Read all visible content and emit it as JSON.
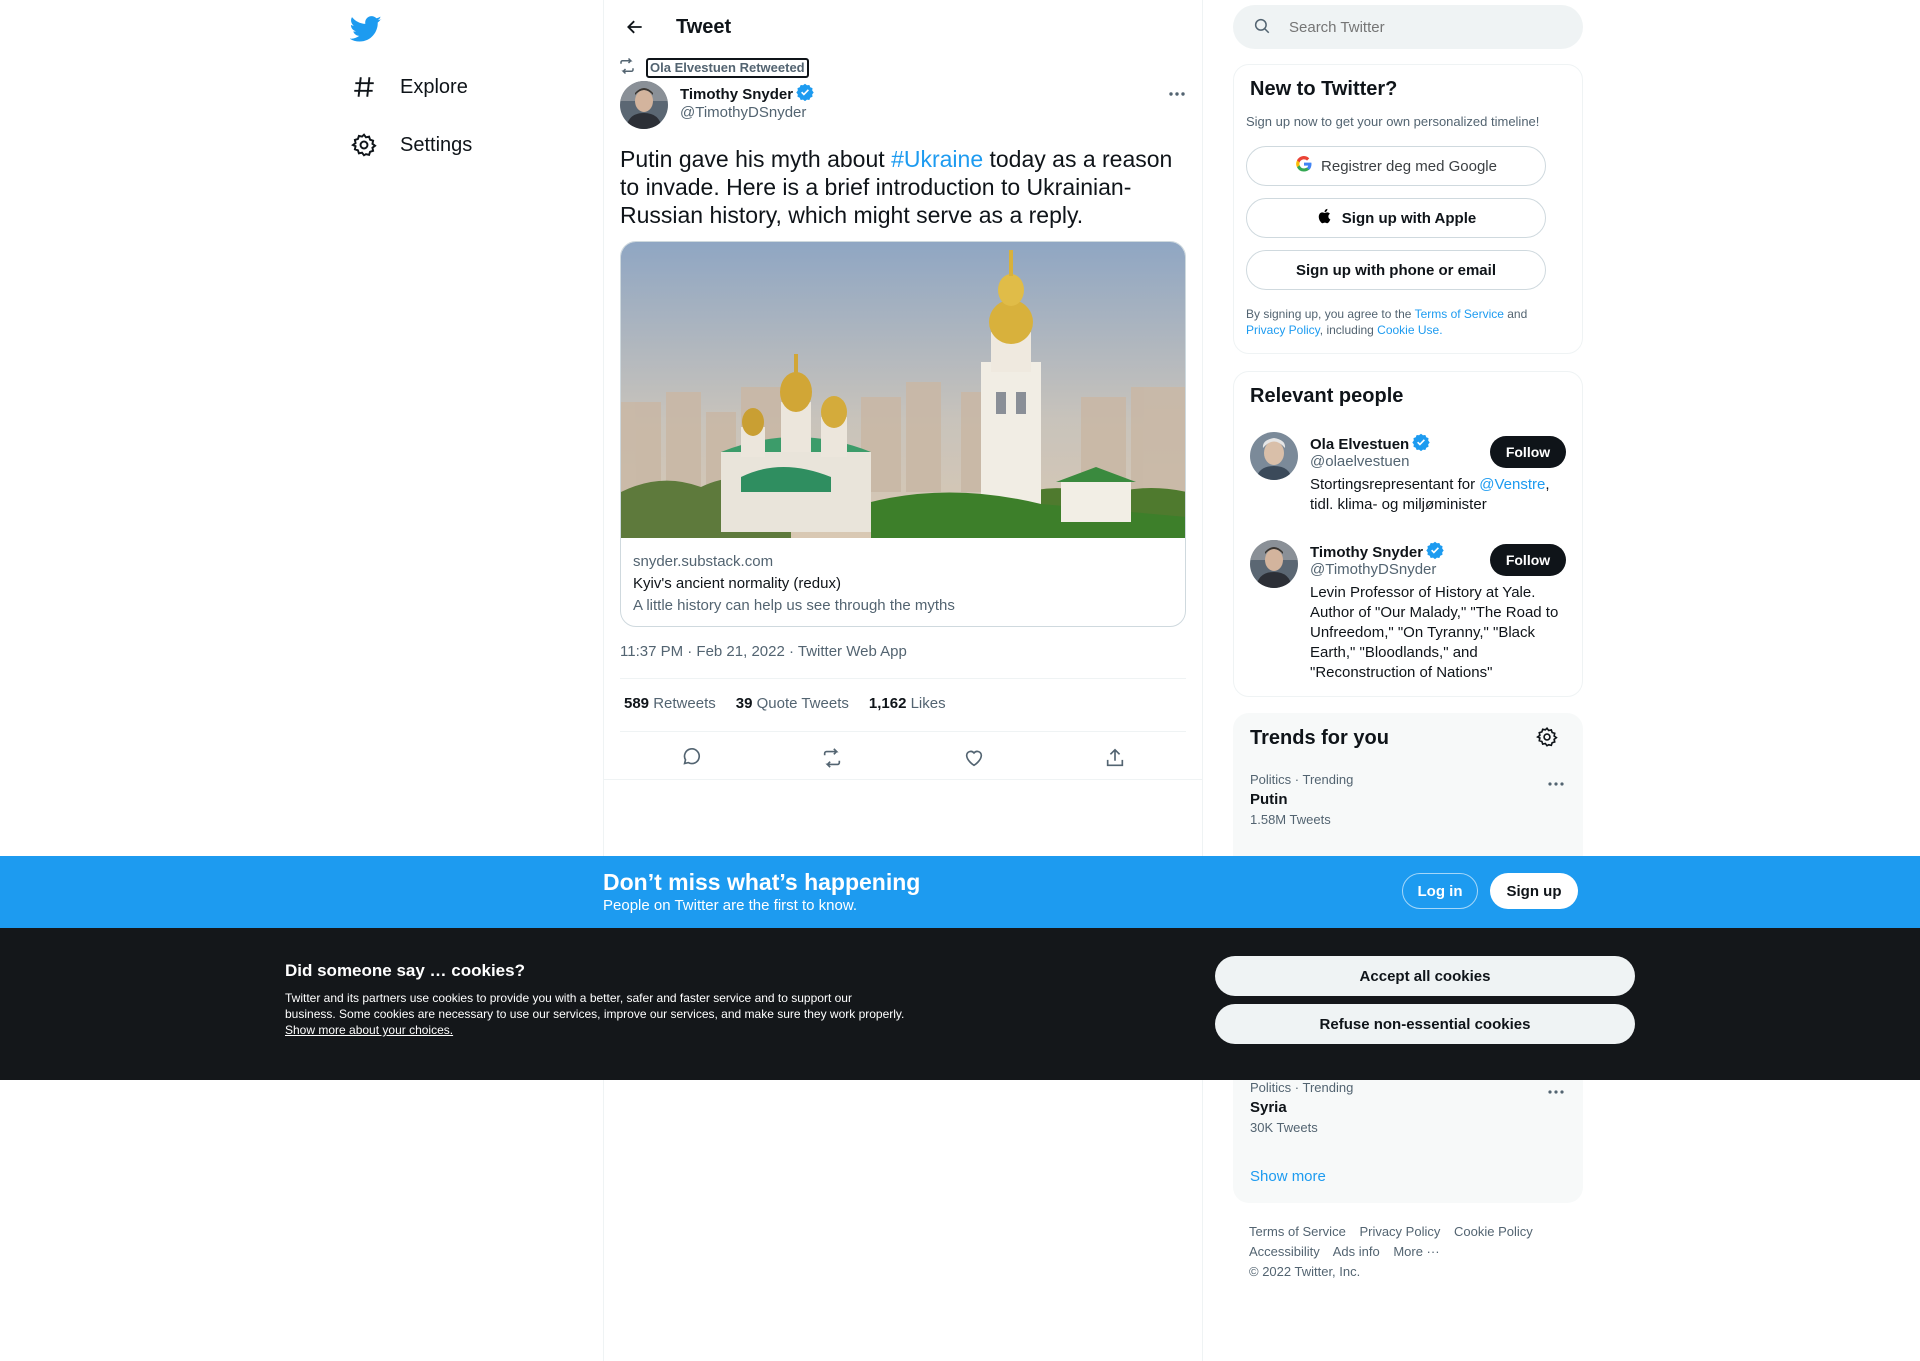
{
  "nav": {
    "items": [
      {
        "label": "Explore",
        "icon": "hashtag-icon"
      },
      {
        "label": "Settings",
        "icon": "gear-icon"
      }
    ]
  },
  "header": {
    "title": "Tweet"
  },
  "tweet": {
    "retweeted_by": "Ola Elvestuen Retweeted",
    "author_name": "Timothy Snyder",
    "author_handle": "@TimothyDSnyder",
    "text_before": "Putin gave his myth about ",
    "hashtag": "#Ukraine",
    "text_after": " today as a reason to invade. Here is a brief introduction to Ukrainian-Russian history, which might serve as a reply.",
    "card": {
      "domain": "snyder.substack.com",
      "title": "Kyiv's ancient normality (redux)",
      "description": "A little history can help us see through the myths"
    },
    "timestamp": "11:37 PM · Feb 21, 2022 · Twitter Web App",
    "stats": [
      {
        "count": "589",
        "label": "Retweets"
      },
      {
        "count": "39",
        "label": "Quote Tweets"
      },
      {
        "count": "1,162",
        "label": "Likes"
      }
    ]
  },
  "search": {
    "placeholder": "Search Twitter"
  },
  "new_to_twitter": {
    "title": "New to Twitter?",
    "subtitle": "Sign up now to get your own personalized timeline!",
    "google_label": "Registrer deg med Google",
    "apple_label": "Sign up with Apple",
    "phone_label": "Sign up with phone or email",
    "legal_prefix": "By signing up, you agree to the ",
    "terms": "Terms of Service",
    "and": " and",
    "privacy": "Privacy Policy",
    "including": ", including ",
    "cookie": "Cookie Use."
  },
  "relevant": {
    "title": "Relevant people",
    "people": [
      {
        "name": "Ola Elvestuen",
        "handle": "@olaelvestuen",
        "bio_prefix": "Stortingsrepresentant for ",
        "bio_link": "@Venstre",
        "bio_suffix": ", tidl. klima- og miljøminister",
        "follow": "Follow"
      },
      {
        "name": "Timothy Snyder",
        "handle": "@TimothyDSnyder",
        "bio": "Levin Professor of History at Yale. Author of \"Our Malady,\" \"The Road to Unfreedom,\" \"On Tyranny,\" \"Black Earth,\" \"Bloodlands,\" and \"Reconstruction of Nations\"",
        "follow": "Follow"
      }
    ]
  },
  "trends": {
    "title": "Trends for you",
    "items": [
      {
        "category": "Politics · Trending",
        "name": "Putin",
        "count": "1.58M Tweets"
      },
      {
        "category": "Politics · Trending",
        "name": "Syria",
        "count": "30K Tweets"
      }
    ],
    "show_more": "Show more"
  },
  "footer": {
    "links1": [
      "Terms of Service",
      "Privacy Policy",
      "Cookie Policy"
    ],
    "links2": [
      "Accessibility",
      "Ads info",
      "More ···"
    ],
    "copyright": "© 2022 Twitter, Inc."
  },
  "banner": {
    "title": "Don’t miss what’s happening",
    "subtitle": "People on Twitter are the first to know.",
    "login": "Log in",
    "signup": "Sign up"
  },
  "cookies": {
    "title": "Did someone say … cookies?",
    "text": "Twitter and its partners use cookies to provide you with a better, safer and faster service and to support our business. Some cookies are necessary to use our services, improve our services, and make sure they work properly. ",
    "link": "Show more about your choices.",
    "accept": "Accept all cookies",
    "refuse": "Refuse non-essential cookies"
  },
  "colors": {
    "accent": "#1d9bf0",
    "text": "#0f1419",
    "muted": "#536471",
    "cookie_bg": "#14171a"
  }
}
